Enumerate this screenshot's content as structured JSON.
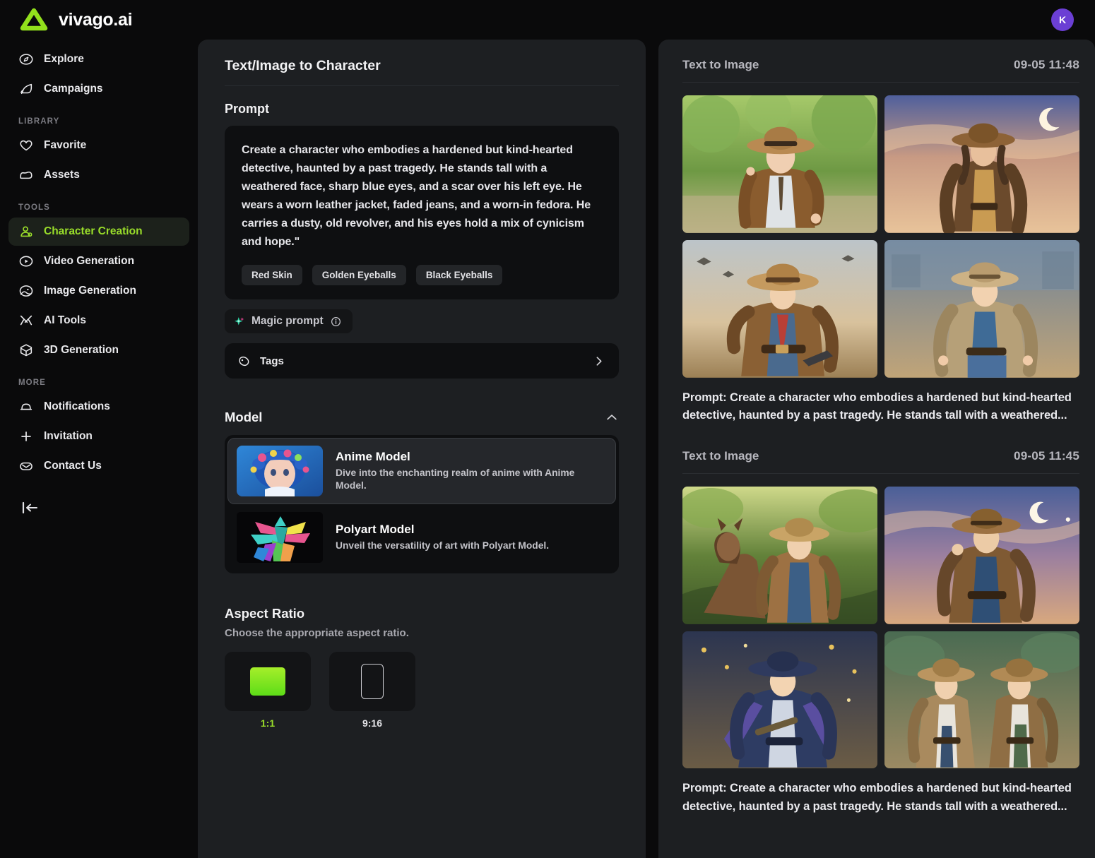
{
  "brand": {
    "name": "vivago.ai",
    "logo_icon": "triangle-logo-icon",
    "accent": "#9ade2a"
  },
  "account": {
    "avatar_initial": "K",
    "avatar_color": "#6b3fd4"
  },
  "sidebar": {
    "top_items": [
      {
        "label": "Explore",
        "icon": "compass-icon"
      },
      {
        "label": "Campaigns",
        "icon": "megaphone-icon"
      }
    ],
    "library_label": "LIBRARY",
    "library_items": [
      {
        "label": "Favorite",
        "icon": "heart-icon"
      },
      {
        "label": "Assets",
        "icon": "folder-icon"
      }
    ],
    "tools_label": "TOOLS",
    "tools_items": [
      {
        "label": "Character Creation",
        "icon": "person-icon",
        "active": true
      },
      {
        "label": "Video Generation",
        "icon": "video-play-icon",
        "active": false
      },
      {
        "label": "Image Generation",
        "icon": "image-icon",
        "active": false
      },
      {
        "label": "AI Tools",
        "icon": "tools-icon",
        "active": false
      },
      {
        "label": "3D Generation",
        "icon": "cube-icon",
        "active": false
      }
    ],
    "more_label": "MORE",
    "more_items": [
      {
        "label": "Notifications",
        "icon": "bell-icon"
      },
      {
        "label": "Invitation",
        "icon": "plus-icon"
      },
      {
        "label": "Contact Us",
        "icon": "envelope-icon"
      }
    ],
    "collapse_icon": "collapse-sidebar-icon"
  },
  "editor": {
    "title": "Text/Image to Character",
    "prompt_label": "Prompt",
    "prompt_value": "Create a character who embodies a hardened but kind-hearted detective, haunted by a past tragedy. He stands tall with a weathered face, sharp blue eyes, and a scar over his left eye. He wears a worn leather jacket, faded jeans, and a worn-in fedora. He carries a dusty, old revolver, and his eyes hold a mix of cynicism and hope.\"",
    "suggestion_chips": [
      "Red Skin",
      "Golden Eyeballs",
      "Black Eyeballs"
    ],
    "magic_prompt_label": "Magic prompt",
    "magic_prompt_icon": "sparkle-icon",
    "magic_prompt_info_icon": "info-icon",
    "tags_label": "Tags",
    "tags_icon": "tag-icon",
    "tags_chevron_icon": "chevron-right-icon",
    "model_section_label": "Model",
    "model_collapse_icon": "chevron-up-icon",
    "models": [
      {
        "name": "Anime Model",
        "description": "Dive into the enchanting realm of anime with Anime Model.",
        "selected": true
      },
      {
        "name": "Polyart Model",
        "description": "Unveil the versatility of art with Polyart Model.",
        "selected": false
      }
    ],
    "aspect_section_label": "Aspect Ratio",
    "aspect_hint": "Choose the appropriate aspect ratio.",
    "aspect_options": [
      {
        "label": "1:1",
        "selected": true
      },
      {
        "label": "9:16",
        "selected": false
      }
    ]
  },
  "feed": {
    "groups": [
      {
        "kind": "Text to Image",
        "time": "09-05 11:48",
        "caption": "Prompt: Create a character who embodies a hardened but kind-hearted detective, haunted by a past tragedy. He stands tall with a weathered...",
        "images": [
          "forest-detective",
          "sunset-cowboy",
          "hat-tip-detective",
          "blue-shirt-detective"
        ]
      },
      {
        "kind": "Text to Image",
        "time": "09-05 11:45",
        "caption": "Prompt: Create a character who embodies a hardened but kind-hearted detective, haunted by a past tragedy. He stands tall with a weathered...",
        "images": [
          "jungle-horse-rider",
          "dusk-detective",
          "falling-leaves-detective",
          "duo-detectives"
        ]
      }
    ]
  }
}
